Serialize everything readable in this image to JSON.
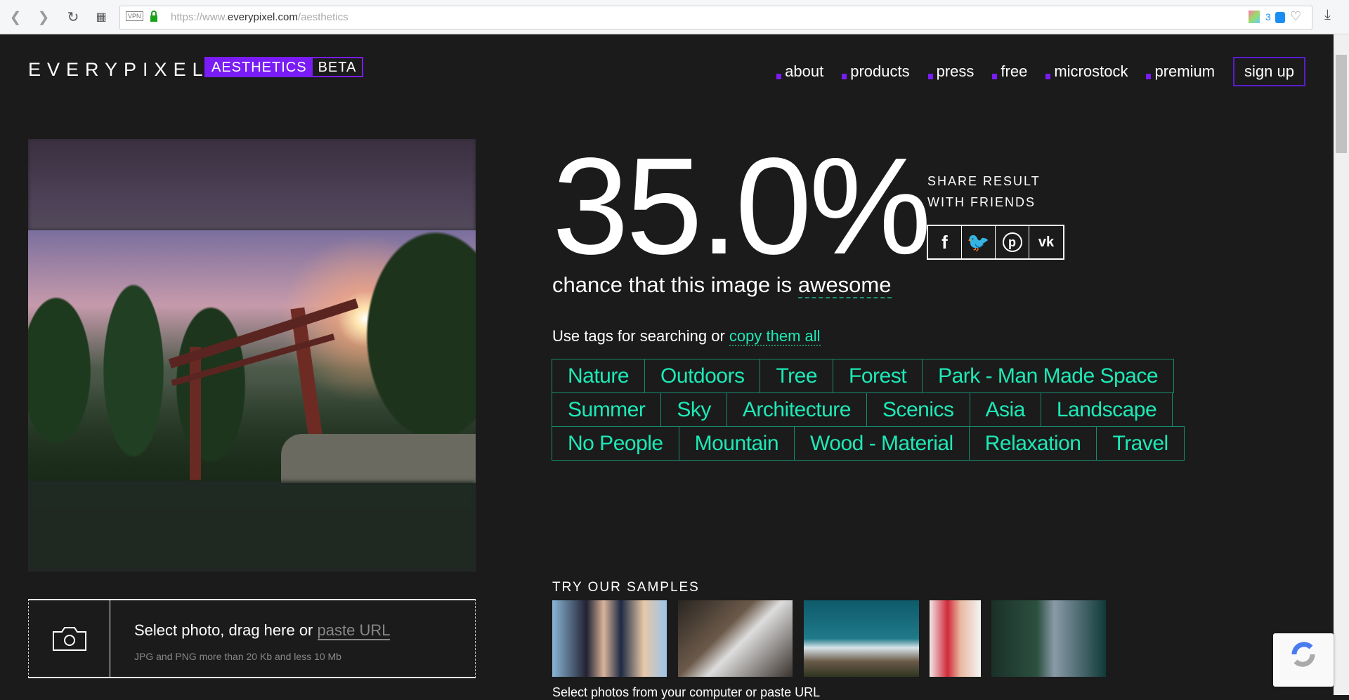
{
  "browser": {
    "vpn": "VPN",
    "url_prefix": "https://www.",
    "url_domain": "everypixel.com",
    "url_path": "/aesthetics",
    "ext_count": "3"
  },
  "header": {
    "logo": "EVERYPIXEL",
    "badge_main": "AESTHETICS",
    "badge_beta": "BETA",
    "nav": [
      "about",
      "products",
      "press",
      "free",
      "microstock",
      "premium"
    ],
    "signup": "sign up"
  },
  "result": {
    "score": "35.0%",
    "share_line1": "SHARE RESULT",
    "share_line2": "WITH FRIENDS",
    "chance_prefix": "chance that this image is",
    "chance_word": "awesome"
  },
  "social": [
    "f",
    "t",
    "p",
    "vk"
  ],
  "tags_intro": {
    "text": "Use tags for searching or",
    "link": "copy them all"
  },
  "tags": [
    [
      "Nature",
      "Outdoors",
      "Tree",
      "Forest",
      "Park - Man Made Space"
    ],
    [
      "Summer",
      "Sky",
      "Architecture",
      "Scenics",
      "Asia",
      "Landscape"
    ],
    [
      "No People",
      "Mountain",
      "Wood - Material",
      "Relaxation",
      "Travel"
    ]
  ],
  "samples": {
    "title": "TRY OUR SAMPLES",
    "footer": "Select photos from your computer or paste URL"
  },
  "upload": {
    "prefix": "Select photo, drag here or",
    "link": "paste URL",
    "hint": "JPG and PNG more than 20 Kb and less 10 Mb"
  },
  "colors": {
    "accent": "#7a1cf6",
    "tag": "#1de9b6",
    "bg": "#1b1b1b"
  }
}
